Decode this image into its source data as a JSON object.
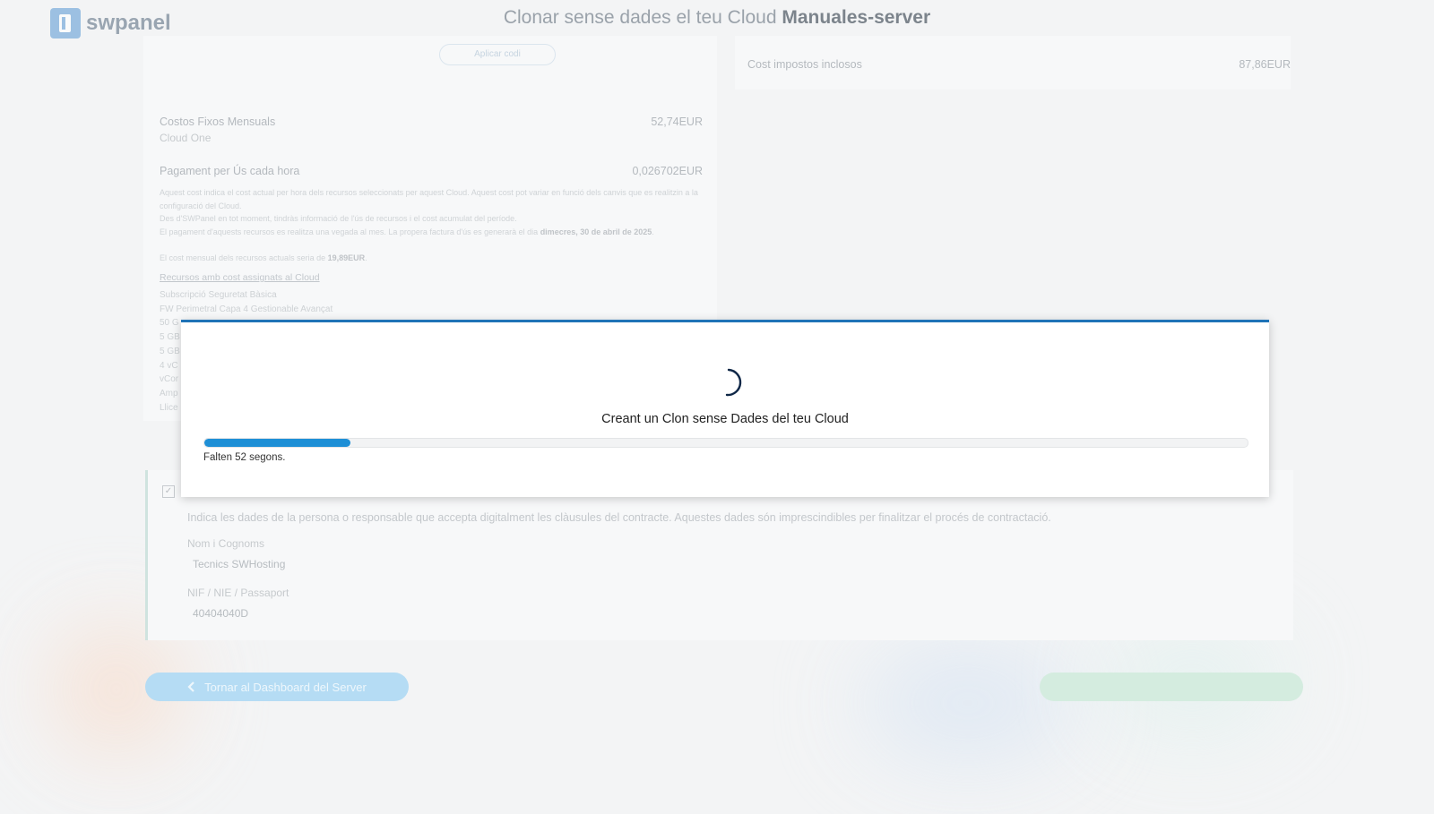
{
  "header": {
    "logo_text": "swpanel",
    "title_prefix": "Clonar sense dades el teu Cloud ",
    "title_server": "Manuales-server"
  },
  "top_button": {
    "label": "Aplicar codi"
  },
  "summary": {
    "tax_label": "Cost impostos inclosos",
    "tax_value": "87,86EUR"
  },
  "costs": {
    "fixed_label": "Costos Fixos Mensuals",
    "fixed_value": "52,74EUR",
    "fixed_sub": "Cloud One",
    "hourly_label": "Pagament per Ús cada hora",
    "hourly_value": "0,026702EUR",
    "note_1": "Aquest cost indica el cost actual per hora dels recursos seleccionats per aquest Cloud. Aquest cost pot variar en funció dels canvis que es realitzin a la configuració del Cloud.",
    "note_2": "Des d'SWPanel en tot moment, tindràs informació de l'ús de recursos i el cost acumulat del període.",
    "note_3_prefix": "El pagament d'aquests recursos es realitza una vegada al mes. La propera factura d'ús es generarà el dia ",
    "note_3_date": "dimecres, 30 de abril de 2025",
    "note_3_suffix": ".",
    "note_4_prefix": "El cost mensual dels recursos actuals seria de ",
    "note_4_value": "19,89EUR",
    "note_4_suffix": ".",
    "resources_link": "Recursos amb cost assignats al Cloud",
    "resources": [
      "Subscripció Seguretat Bàsica",
      "FW Perimetral Capa 4 Gestionable Avançat",
      "50 G",
      "5 GB",
      "5 GB",
      "4 vC",
      "vCor",
      "Amp",
      "Llice"
    ]
  },
  "contract": {
    "check_mark": "✓",
    "instruction": "Indica les dades de la persona o responsable que accepta digitalment les clàusules del contracte. Aquestes dades són imprescindibles per finalitzar el procés de contractació.",
    "name_label": "Nom i Cognoms",
    "name_value": "Tecnics SWHosting",
    "id_label": "NIF / NIE / Passaport",
    "id_value": "40404040D"
  },
  "footer": {
    "back_label": "Tornar al Dashboard del Server"
  },
  "modal": {
    "title": "Creant un Clon sense Dades del teu Cloud",
    "progress_percent": 14,
    "remaining_text": "Falten 52 segons."
  },
  "colors": {
    "accent": "#1f73b7",
    "progress": "#1e8fd6"
  }
}
